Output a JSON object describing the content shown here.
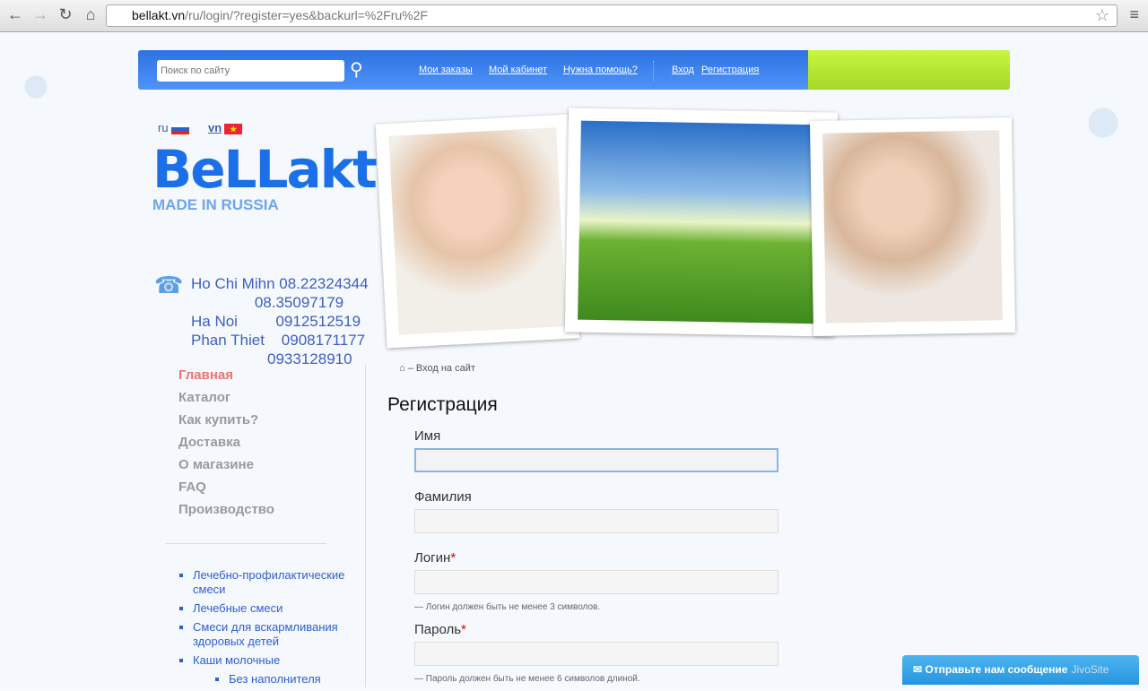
{
  "browser": {
    "url_host": "bellakt.vn",
    "url_rest": "/ru/login/?register=yes&backurl=%2Fru%2F"
  },
  "topbar": {
    "search_placeholder": "Поиск по сайту",
    "links": [
      "Мои заказы",
      "Мой кабинет",
      "Нужна помощь?"
    ],
    "login": "Вход",
    "register": "Регистрация"
  },
  "langs": {
    "ru": "ru",
    "vn": "vn"
  },
  "logo": {
    "name": "BeLLakt",
    "tagline": "MADE IN RUSSIA"
  },
  "phones": [
    "Ho Chi Mihn 08.22324344",
    "               08.35097179",
    "Ha Noi         0912512519",
    "Phan Thiet    0908171177",
    "                  0933128910"
  ],
  "nav": [
    "Главная",
    "Каталог",
    "Как купить?",
    "Доставка",
    "О магазине",
    "FAQ",
    "Производство"
  ],
  "categories": [
    "Лечебно-профилактические смеси",
    "Лечебные смеси",
    "Смеси для вскармливания здоровых детей",
    "Каши молочные",
    "Без наполнителя"
  ],
  "breadcrumb": "– Вход на сайт",
  "form": {
    "title": "Регистрация",
    "first_name": "Имя",
    "last_name": "Фамилия",
    "login": "Логин",
    "password": "Пароль",
    "required": "*",
    "login_hint": "— Логин должен быть не менее 3 символов.",
    "password_hint": "— Пароль должен быть не менее 6 символов длиной."
  },
  "jivo": {
    "text": "Отправьте нам сообщение",
    "brand": "JivoSite"
  },
  "colors": {
    "accent": "#2e72e4",
    "green": "#b8e834",
    "active_nav": "#f07373"
  }
}
